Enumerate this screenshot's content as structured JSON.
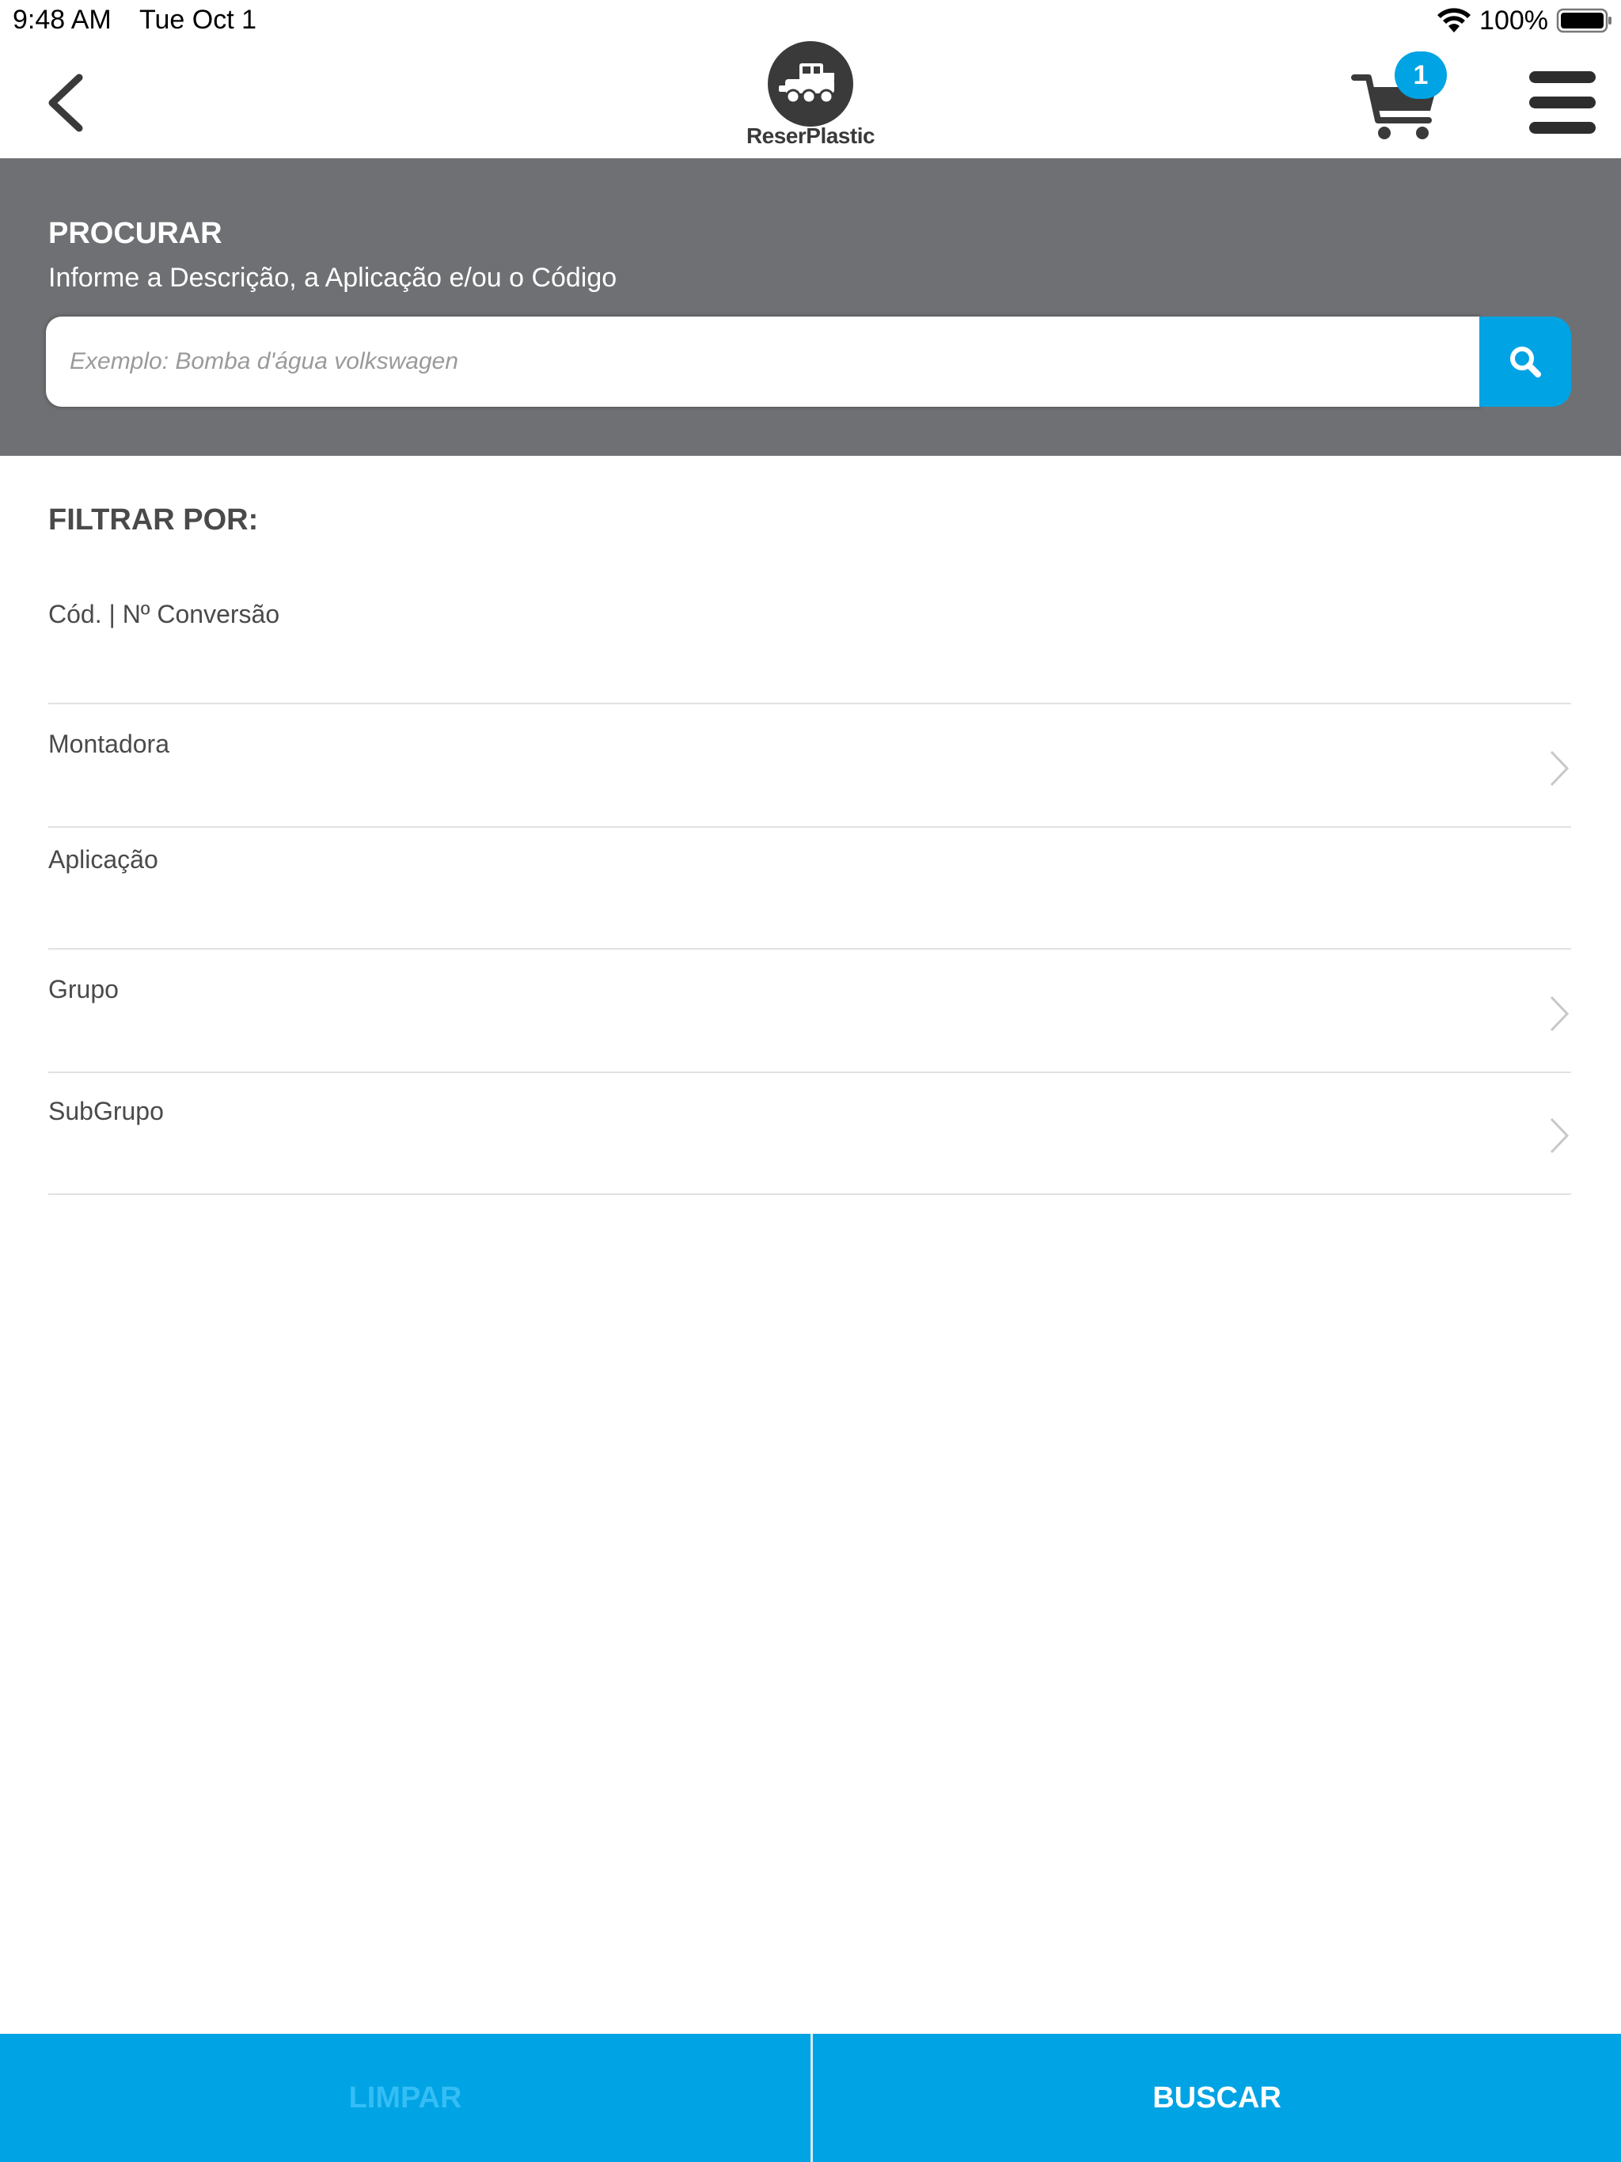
{
  "status_bar": {
    "time": "9:48 AM",
    "date": "Tue Oct 1",
    "battery_percent": "100%",
    "icons": [
      "wifi-icon",
      "battery-icon"
    ]
  },
  "header": {
    "logo_text_prefix": "Reser",
    "logo_text_suffix": "Plastic",
    "cart_count": "1",
    "icons": [
      "back-chevron-icon",
      "truck-logo-icon",
      "cart-icon",
      "hamburger-menu-icon"
    ]
  },
  "search": {
    "title": "PROCURAR",
    "subtitle": "Informe a Descrição, a Aplicação e/ou o Código",
    "placeholder": "Exemplo: Bomba d'água volkswagen",
    "value": "",
    "button_icon": "search-icon"
  },
  "filters": {
    "heading": "FILTRAR POR:",
    "items": [
      {
        "label": "Cód. | Nº Conversão",
        "has_chevron": false
      },
      {
        "label": "Montadora",
        "has_chevron": true
      },
      {
        "label": "Aplicação",
        "has_chevron": false
      },
      {
        "label": "Grupo",
        "has_chevron": true
      },
      {
        "label": "SubGrupo",
        "has_chevron": true
      }
    ]
  },
  "actions": {
    "clear_label": "LIMPAR",
    "search_label": "BUSCAR"
  },
  "colors": {
    "accent": "#00a3e3",
    "panel": "#6f7073",
    "text_dark": "#4a4a4a"
  }
}
